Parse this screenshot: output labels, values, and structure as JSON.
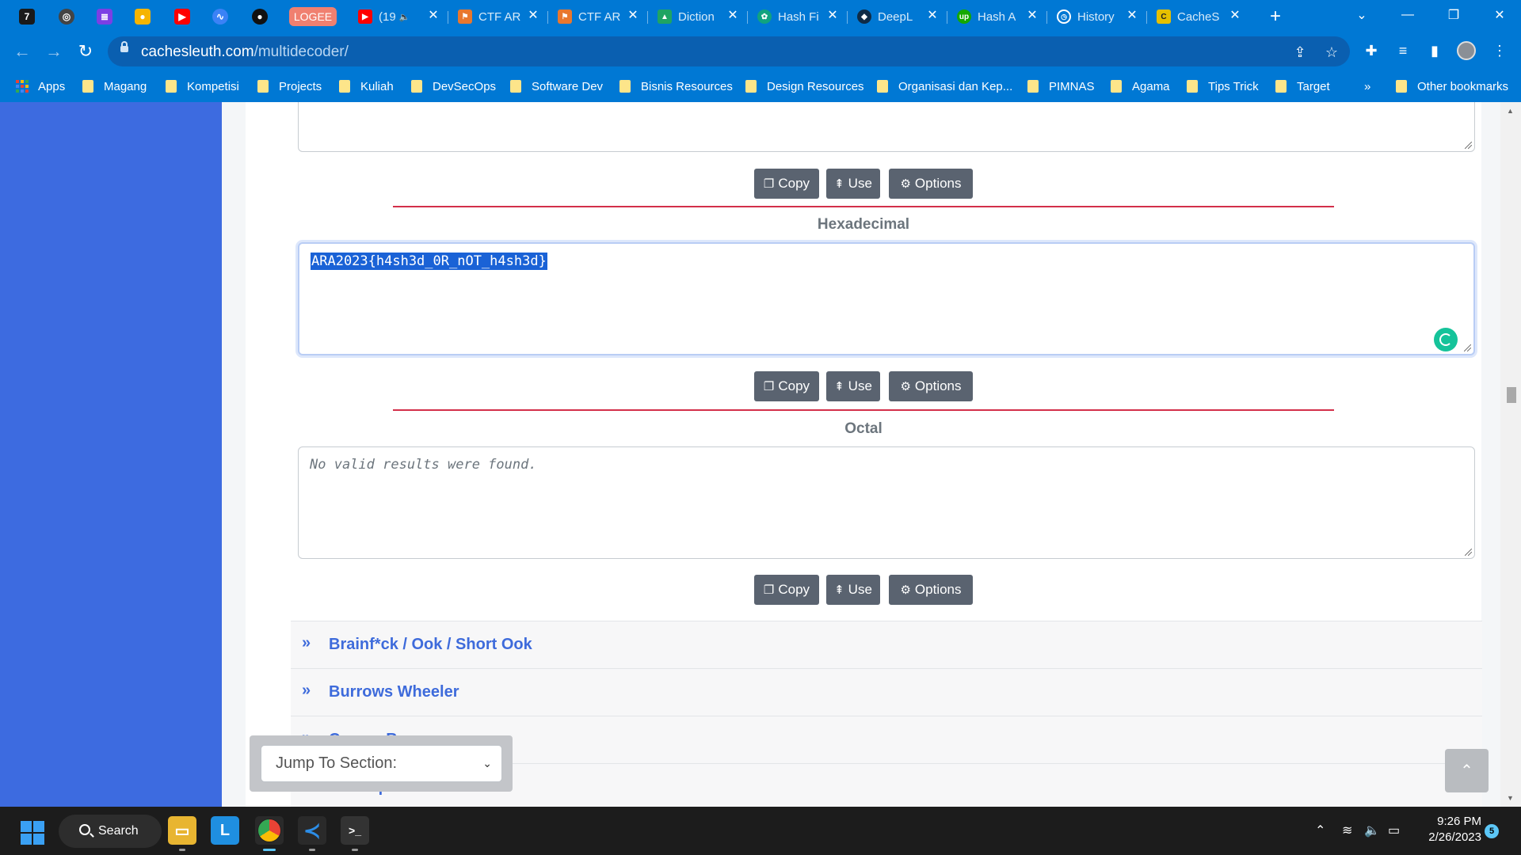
{
  "browser": {
    "pinned_tabs": [
      {
        "icon": "ctf-7-icon",
        "color": "#1a1a1a",
        "glyph": "7"
      },
      {
        "icon": "globe-icon",
        "color": "#444444",
        "glyph": "◎"
      },
      {
        "icon": "notes-icon",
        "color": "#7b3fe4",
        "glyph": "≣"
      },
      {
        "icon": "keep-icon",
        "color": "#f6b400",
        "glyph": "●"
      },
      {
        "icon": "youtube-icon",
        "color": "#ff0000",
        "glyph": "▶"
      },
      {
        "icon": "messenger-icon",
        "color": "#3b82f6",
        "glyph": "∿"
      },
      {
        "icon": "github-icon",
        "color": "#111111",
        "glyph": "●"
      }
    ],
    "logee_label": "LOGEE",
    "tabs": [
      {
        "title": "(19",
        "icon": "youtube-icon",
        "color": "#ff0000",
        "extra": "🔈"
      },
      {
        "title": "CTF AR",
        "icon": "ctf-icon",
        "color": "#e8772e"
      },
      {
        "title": "CTF AR",
        "icon": "ctf-icon",
        "color": "#e8772e"
      },
      {
        "title": "Diction",
        "icon": "google-drive-icon",
        "color": "#1fa463"
      },
      {
        "title": "Hash Fi",
        "icon": "chatgpt-icon",
        "color": "#10a37f"
      },
      {
        "title": "DeepL",
        "icon": "deepl-icon",
        "color": "#0f2b46"
      },
      {
        "title": "Hash A",
        "icon": "upwork-icon",
        "color": "#14a800"
      },
      {
        "title": "History",
        "icon": "history-icon",
        "color": "#0078d4"
      },
      {
        "title": "CacheS",
        "icon": "cachesleuth-icon",
        "color": "#e5c000"
      }
    ],
    "new_tab": "+",
    "url_domain": "cachesleuth.com",
    "url_path": "/multidecoder/"
  },
  "bookmarks": {
    "apps_label": "Apps",
    "items": [
      "Magang",
      "Kompetisi",
      "Projects",
      "Kuliah",
      "DevSecOps",
      "Software Dev",
      "Bisnis Resources",
      "Design Resources",
      "Organisasi dan Kep...",
      "PIMNAS",
      "Agama",
      "Tips Trick",
      "Target"
    ],
    "more": "»",
    "other": "Other bookmarks"
  },
  "decoder": {
    "buttons": {
      "copy": "Copy",
      "use": "Use",
      "options": "Options"
    },
    "hex_title": "Hexadecimal",
    "hex_output": "ARA2023{h4sh3d_0R_nOT_h4sh3d}",
    "octal_title": "Octal",
    "octal_output": "No valid results were found.",
    "sections": [
      "Brainf*ck / Ook / Short Ook",
      "Burrows Wheeler",
      "Caesar Box",
      "Chaocipher"
    ],
    "jump_label": "Jump To Section:"
  },
  "taskbar": {
    "search_label": "Search",
    "time": "9:26 PM",
    "date": "2/26/2023",
    "notifications": "5"
  },
  "colors": {
    "accent": "#0078d4",
    "sidebar": "#3d6be0",
    "link": "#3e6bdb",
    "button": "#5a6370",
    "divider": "#d32f4a"
  }
}
